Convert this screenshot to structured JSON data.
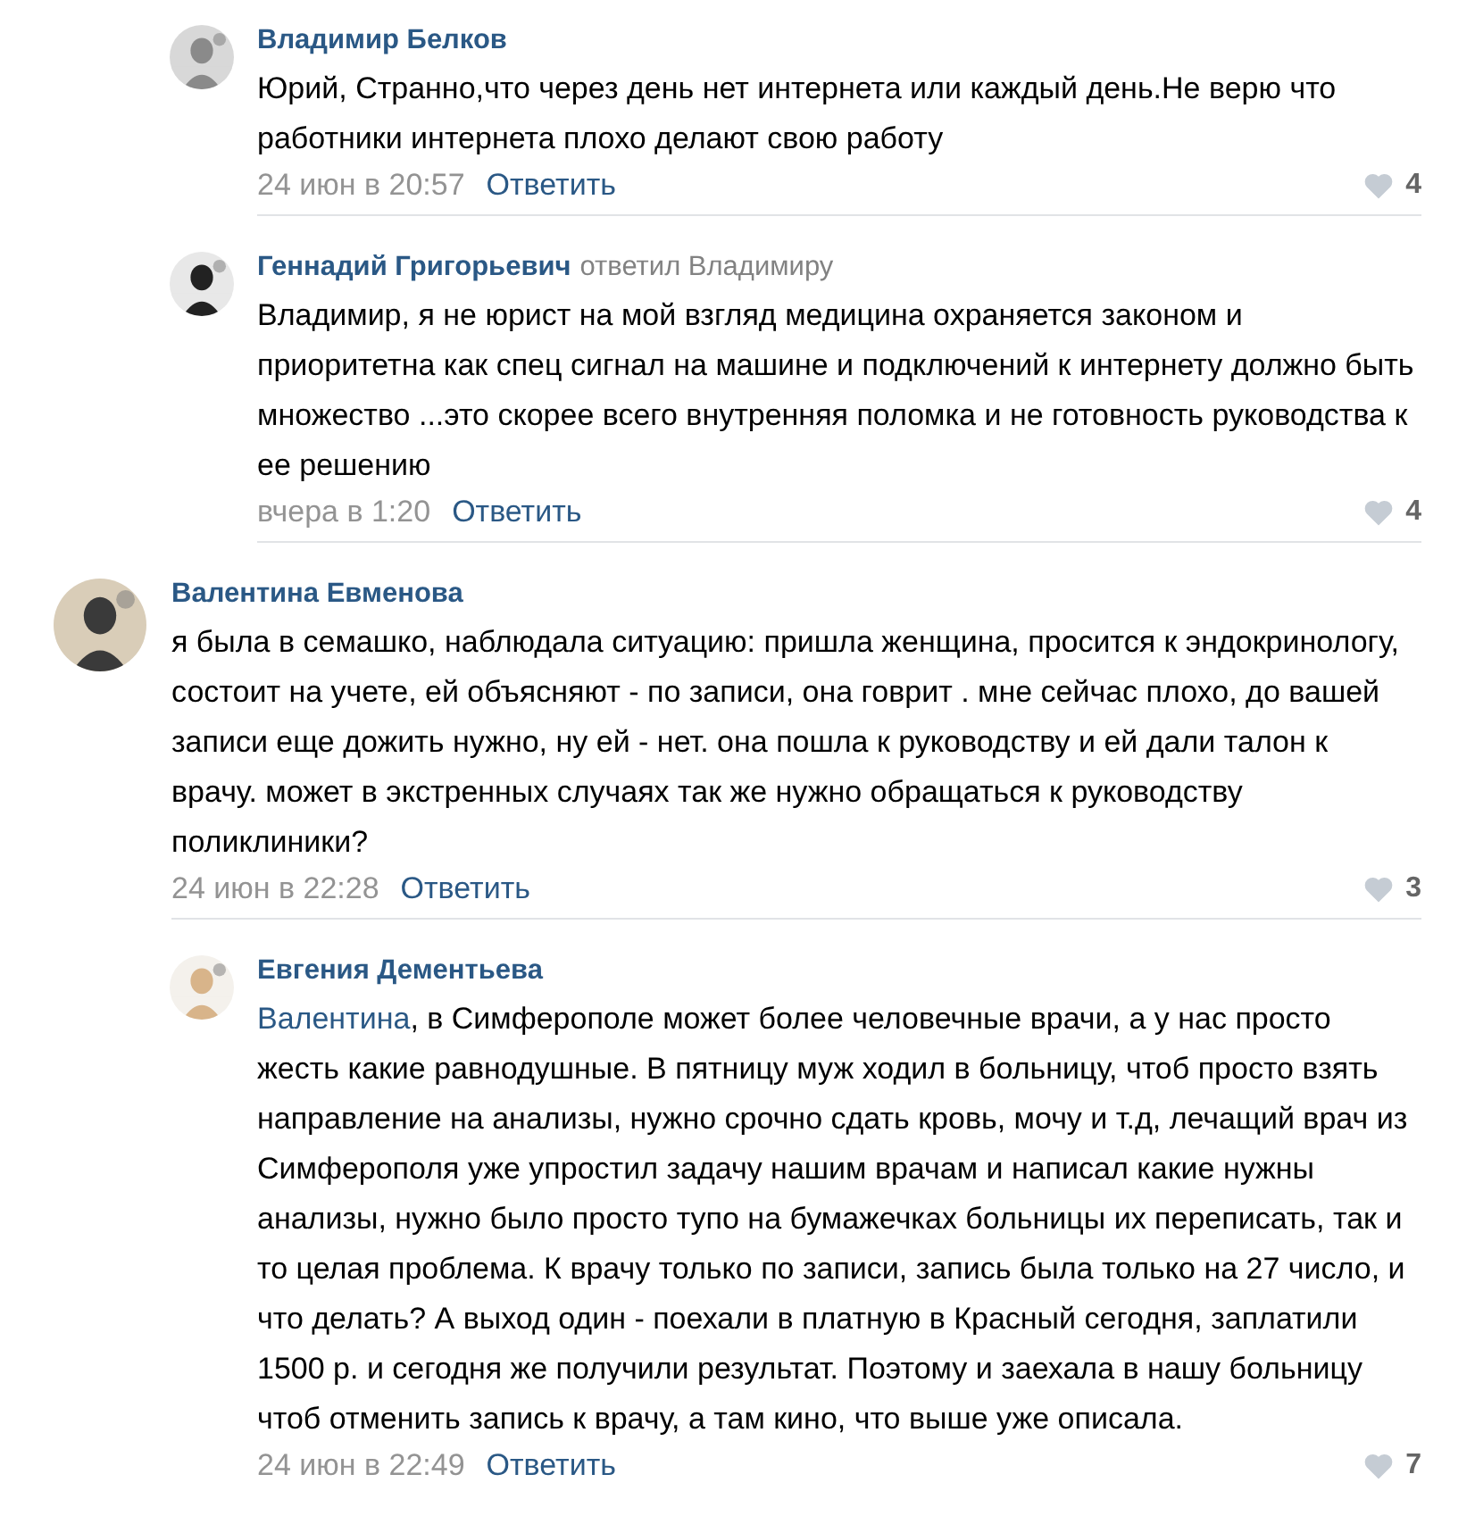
{
  "comments": [
    {
      "kind": "reply",
      "author": "Владимир Белков",
      "text": "Юрий, Странно,что через день нет интернета или каждый день.Не верю что работники интернета плохо делают свою работу",
      "date": "24 июн в 20:57",
      "reply_link": "Ответить",
      "likes": "4"
    },
    {
      "kind": "reply",
      "author": "Геннадий Григорьевич",
      "reply_to": "ответил Владимиру",
      "text": "Владимир, я не юрист на мой взгляд медицина охраняется законом и приоритетна как спец сигнал на машине и подключений к интернету должно быть множество ...это скорее всего внутренняя поломка и не готовность руководства к ее решению",
      "date": "вчера в 1:20",
      "reply_link": "Ответить",
      "likes": "4"
    },
    {
      "kind": "comment",
      "author": "Валентина Евменова",
      "text": "я была в семашко, наблюдала ситуацию: пришла женщина, просится к эндокринологу, состоит на учете, ей объясняют - по записи, она говрит . мне сейчас плохо, до вашей записи еще дожить нужно, ну ей - нет. она пошла к руководству и ей дали талон к врачу. может в экстренных случаях так же нужно обращаться к руководству поликлиники?",
      "date": "24 июн в 22:28",
      "reply_link": "Ответить",
      "likes": "3"
    },
    {
      "kind": "reply",
      "author": "Евгения Дементьева",
      "mention": "Валентина",
      "text": ", в Симферополе может более человечные врачи, а у нас просто жесть какие равнодушные. В пятницу муж ходил в больницу, чтоб просто взять направление на анализы, нужно срочно сдать кровь, мочу и т.д, лечащий врач из Симферополя уже упростил задачу нашим врачам и написал какие нужны анализы, нужно было просто тупо на бумажечках больницы их переписать, так и то целая проблема. К врачу только по записи, запись была только на 27 число, и что делать? А выход один - поехали в платную в Красный сегодня, заплатили 1500 р. и сегодня же получили результат. Поэтому и заехала в нашу больницу чтоб отменить запись к врачу, а там кино, что выше уже описала.",
      "date": "24 июн в 22:49",
      "reply_link": "Ответить",
      "likes": "7"
    }
  ]
}
